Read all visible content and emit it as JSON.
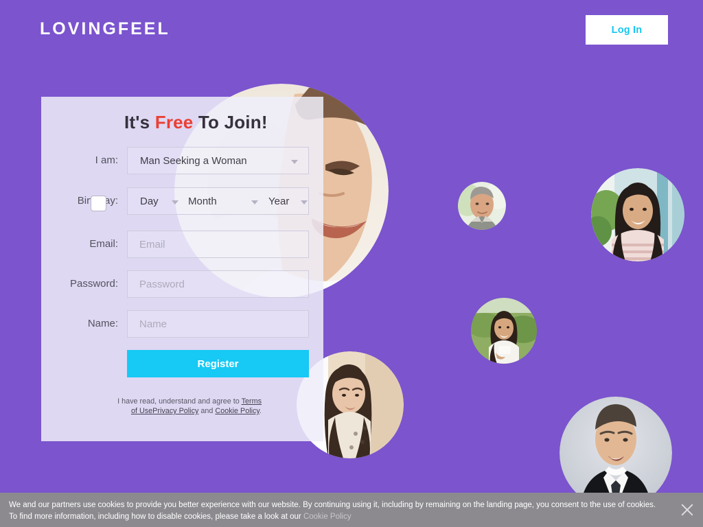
{
  "header": {
    "logo": "LOVINGFEEL",
    "login_label": "Log In"
  },
  "form": {
    "heading_before": "It's ",
    "heading_accent": "Free",
    "heading_after": " To Join!",
    "labels": {
      "iam": "I am:",
      "birthday": "Birthday:",
      "email": "Email:",
      "password": "Password:",
      "name": "Name:"
    },
    "iam_value": "Man Seeking a Woman",
    "birthday": {
      "day": "Day",
      "month": "Month",
      "year": "Year"
    },
    "email_placeholder": "Email",
    "email_value": "",
    "password_placeholder": "Password",
    "password_value": "",
    "name_placeholder": "Name",
    "name_value": "",
    "register_label": "Register",
    "consent": {
      "text_1": "I have read, understand and agree to ",
      "link_terms": "Terms of Use",
      "link_privacy": "Privacy Policy",
      "text_2": " and ",
      "link_cookie": "Cookie Policy",
      "text_3": "."
    }
  },
  "cookie_banner": {
    "text_1": "We and our partners use cookies to provide you better experience with our website. By continuing using it, including by remaining on the landing page, you consent to the use of cookies. To find more information, including how to disable cookies, please take a look at our ",
    "link": "Cookie Policy",
    "close_icon": "close-icon"
  },
  "photos": {
    "hero": "smiling-man-hero-photo",
    "avatar_man_1": "man-avatar-photo",
    "avatar_woman_1": "woman-avatar-photo",
    "avatar_woman_2": "woman-outdoors-avatar-photo",
    "avatar_woman_3": "young-woman-avatar-photo",
    "avatar_man_2": "man-in-suit-avatar-photo"
  },
  "colors": {
    "background": "#7b54ce",
    "card": "#efedf9",
    "accent_cyan": "#17c9f5",
    "accent_red": "#eb4034",
    "banner": "#8c8a8f"
  }
}
